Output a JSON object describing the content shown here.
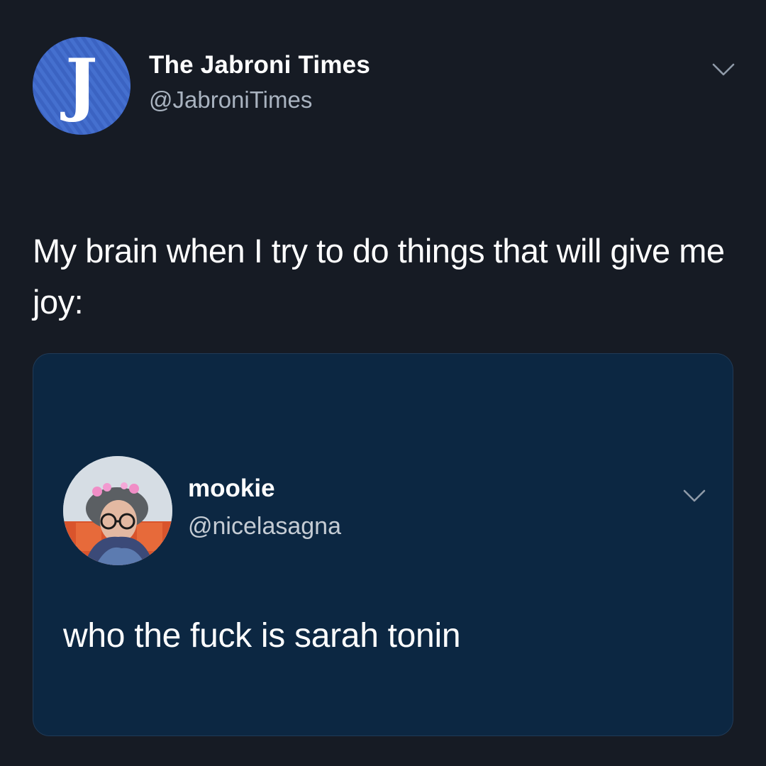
{
  "tweet": {
    "author": {
      "name": "The Jabroni Times",
      "handle": "@JabroniTimes",
      "avatar_letter": "J",
      "avatar_color": "#3a63c4"
    },
    "text": "My brain when I try to do things that will give me joy:",
    "menu_icon": "chevron-down-icon"
  },
  "quoted_tweet": {
    "author": {
      "name": "mookie",
      "handle": "@nicelasagna"
    },
    "text": "who the fuck is sarah tonin",
    "menu_icon": "chevron-down-icon",
    "card_color": "#0c2742"
  },
  "colors": {
    "background": "#161b24",
    "primary_text": "#ffffff",
    "secondary_text": "#a9b3c0"
  }
}
